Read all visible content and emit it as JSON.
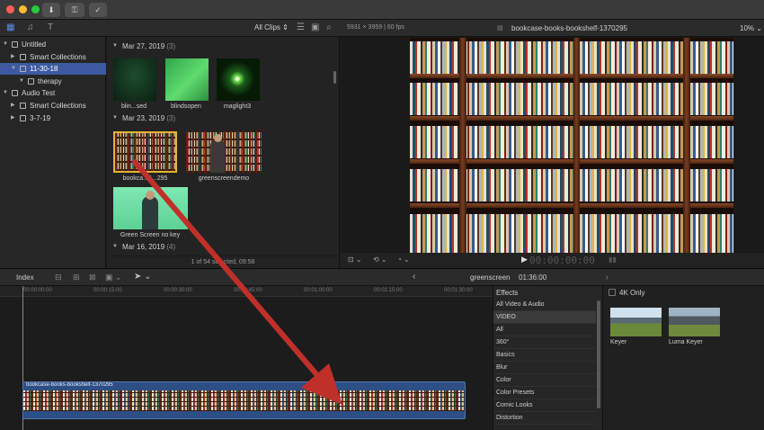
{
  "toolbar": {
    "clips_filter": "All Clips"
  },
  "libraries": [
    {
      "label": "Untitled",
      "level": 0,
      "expanded": true,
      "selected": false
    },
    {
      "label": "Smart Collections",
      "level": 1,
      "expanded": false,
      "selected": false
    },
    {
      "label": "11-30-18",
      "level": 1,
      "expanded": true,
      "selected": true
    },
    {
      "label": "therapy",
      "level": 2,
      "expanded": true,
      "selected": false
    },
    {
      "label": "Audio Test",
      "level": 0,
      "expanded": true,
      "selected": false
    },
    {
      "label": "Smart Collections",
      "level": 1,
      "expanded": false,
      "selected": false
    },
    {
      "label": "3-7-19",
      "level": 1,
      "expanded": false,
      "selected": false
    }
  ],
  "browser": {
    "groups": [
      {
        "date": "Mar 27, 2019",
        "count": "(3)"
      },
      {
        "date": "Mar 23, 2019",
        "count": "(3)"
      },
      {
        "date": "Mar 16, 2019",
        "count": "(4)"
      }
    ],
    "clips": [
      {
        "label": "blin...sed"
      },
      {
        "label": "blindsopen"
      },
      {
        "label": "maglight3"
      },
      {
        "label": "bookca...5...295"
      },
      {
        "label": "greenscreendemo"
      },
      {
        "label": "Green Screen no key"
      }
    ],
    "status": "1 of 54 selected, 09:58"
  },
  "viewer": {
    "format": "5931 × 3959 | 60 fps",
    "clip_name": "bookcase-books-bookshelf-1370295",
    "zoom": "10%",
    "timecode": "00:00:00:00"
  },
  "timeline": {
    "index_label": "Index",
    "project_name": "greenscreen",
    "duration": "01:36:00",
    "ruler": [
      "00:00:00:00",
      "00:00:15:00",
      "00:00:30:00",
      "00:00:45:00",
      "00:01:00:00",
      "00:01:15:00",
      "00:01:30:00"
    ],
    "clip_title": "bookcase-books-bookshelf-1370295"
  },
  "effects": {
    "title": "Effects",
    "categories": [
      "All Video & Audio",
      "VIDEO",
      "All",
      "360°",
      "Basics",
      "Blur",
      "Color",
      "Color Presets",
      "Comic Looks",
      "Distortion"
    ],
    "filter_label": "4K Only",
    "items": [
      {
        "label": "Keyer"
      },
      {
        "label": "Luma Keyer"
      }
    ]
  },
  "colors": {
    "selection": "#3d5aa1",
    "clip": "#2d4f86",
    "arrow": "#c0302a"
  }
}
